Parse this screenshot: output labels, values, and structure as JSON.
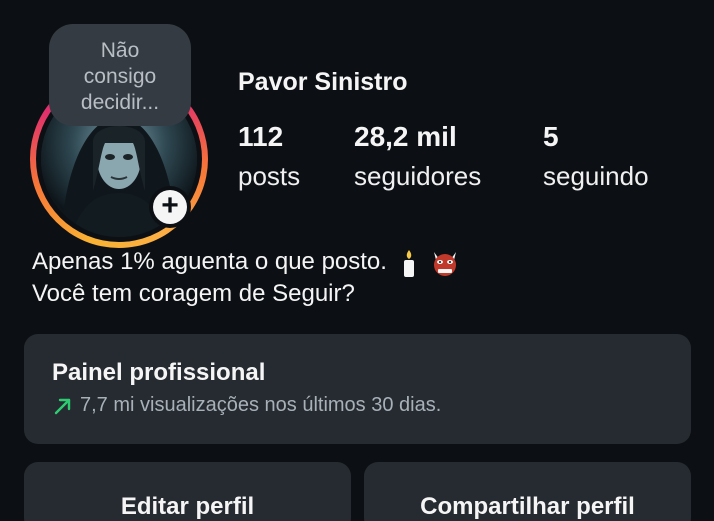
{
  "profile": {
    "note": [
      "Não",
      "consigo",
      "decidir..."
    ],
    "username": "Pavor Sinistro",
    "add_icon": "plus-icon"
  },
  "stats": {
    "posts": {
      "count": "112",
      "label": "posts"
    },
    "followers": {
      "count": "28,2 mil",
      "label": "seguidores"
    },
    "following": {
      "count": "5",
      "label": "seguindo"
    }
  },
  "bio": {
    "line1": "Apenas 1% aguenta o que posto.",
    "line2": "Você tem coragem de Seguir?",
    "emojis": [
      "candle-emoji",
      "ogre-emoji"
    ]
  },
  "dashboard": {
    "title": "Painel profissional",
    "subtitle": "7,7 mi visualizações nos últimos 30 dias.",
    "trend_color": "#2ecc71"
  },
  "actions": {
    "edit": "Editar perfil",
    "share": "Compartilhar perfil"
  },
  "colors": {
    "background": "#0c1014",
    "card": "#262b31",
    "note_bubble": "#343b42"
  }
}
